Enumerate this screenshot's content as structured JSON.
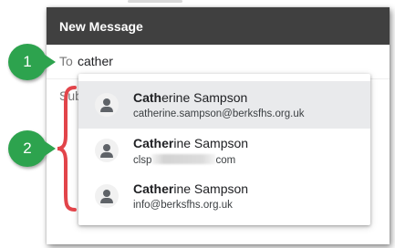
{
  "compose": {
    "title": "New Message",
    "to_label": "To",
    "to_value": "cather",
    "subject_label": "Subject"
  },
  "suggestions": [
    {
      "name_match": "Cath",
      "name_rest": "erine Sampson",
      "email": "catherine.sampson@berksfhs.org.uk",
      "email_prefix": "",
      "email_suffix": "",
      "highlighted": true
    },
    {
      "name_match": "Cather",
      "name_rest": "ine Sampson",
      "email": "",
      "email_prefix": "clsp",
      "email_suffix": "com",
      "highlighted": false
    },
    {
      "name_match": "Cather",
      "name_rest": "ine Sampson",
      "email": "info@berksfhs.org.uk",
      "email_prefix": "",
      "email_suffix": "",
      "highlighted": false
    }
  ],
  "callouts": [
    {
      "number": "1"
    },
    {
      "number": "2"
    }
  ],
  "colors": {
    "titlebar": "#404040",
    "callout": "#2da34e",
    "brace": "#e2444a",
    "highlight": "#e9eaec"
  }
}
